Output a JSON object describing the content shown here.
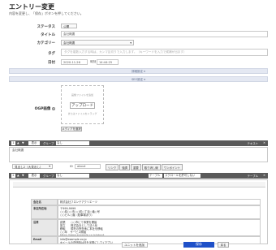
{
  "page": {
    "title": "エントリー変更",
    "subtitle": "内容を変更し、「保存」ボタンを押してください。"
  },
  "form": {
    "status_label": "ステータス",
    "status_value": "公開",
    "title_label": "タイトル",
    "title_value": "会社概要",
    "category_label": "カテゴリー",
    "category_value": "会社概要",
    "tag_label": "タグ",
    "tag_placeholder": "タグを複数入力する時は、カンマ区切りで入力します。（キーワードを入力で候補が出ます）",
    "date_label": "日付",
    "date_value": "2020-11-26",
    "time_label": "時刻",
    "time_value": "14:44:25",
    "detail_bar": "詳細設定",
    "seo_bar": "SEO設定",
    "ogp_label": "OGP画像",
    "ogp_help": "?",
    "drop_text_1": "画像ファイルを追加",
    "upload_label": "アップロード",
    "drop_text_2": "またはファイルをドラッグ",
    "media_select": "メディアを選択"
  },
  "unit1": {
    "num": "1",
    "up": "▲",
    "down": "▼",
    "display": "表示",
    "group_label": "グループ",
    "group_value": "なし",
    "type_label": "テキスト",
    "text_value": "会社概要",
    "style_select": "見出し2（大見出し）",
    "id_label": "ID",
    "id_value": "about",
    "buttons": [
      "リンク",
      "強調",
      "重要",
      "取り消し線",
      "ワンポイント"
    ]
  },
  "unit2": {
    "num": "2",
    "up": "▲",
    "down": "▼",
    "display": "表示",
    "group_label": "グループ",
    "group_value": "なし",
    "mode_value": "テーブル",
    "scroll_value": "スクロールを許可しない",
    "type_label": "テーブル"
  },
  "table": [
    {
      "h": "会社名",
      "v": "株式会社フロンテアクリエーツ"
    },
    {
      "h": "本店所在地",
      "v": "〒999-9999\n○○県○○市○○町○丁目○番○号\n○○ビル○階（駐車場あり）"
    },
    {
      "h": "沿革",
      "v": "創業　　○○市にて事業を開始\n設立　　株式会社として法人化\n移転　　現在の所在地に本社を移転\n○○年　サービス開始\nhttps://www.example.co.jp/about"
    },
    {
      "h": "Email",
      "v": "info@example.co.jp\n※メールの送信時は＠を半角にしてください"
    }
  ],
  "bottom": {
    "unit_placeholder": "ユニットを追加",
    "save_label": "保存",
    "back_label": "戻る"
  },
  "colors": {
    "save": "#1e50c8",
    "unit_bar": "#5a5a5a",
    "section_bar": "#e4e8f2"
  }
}
